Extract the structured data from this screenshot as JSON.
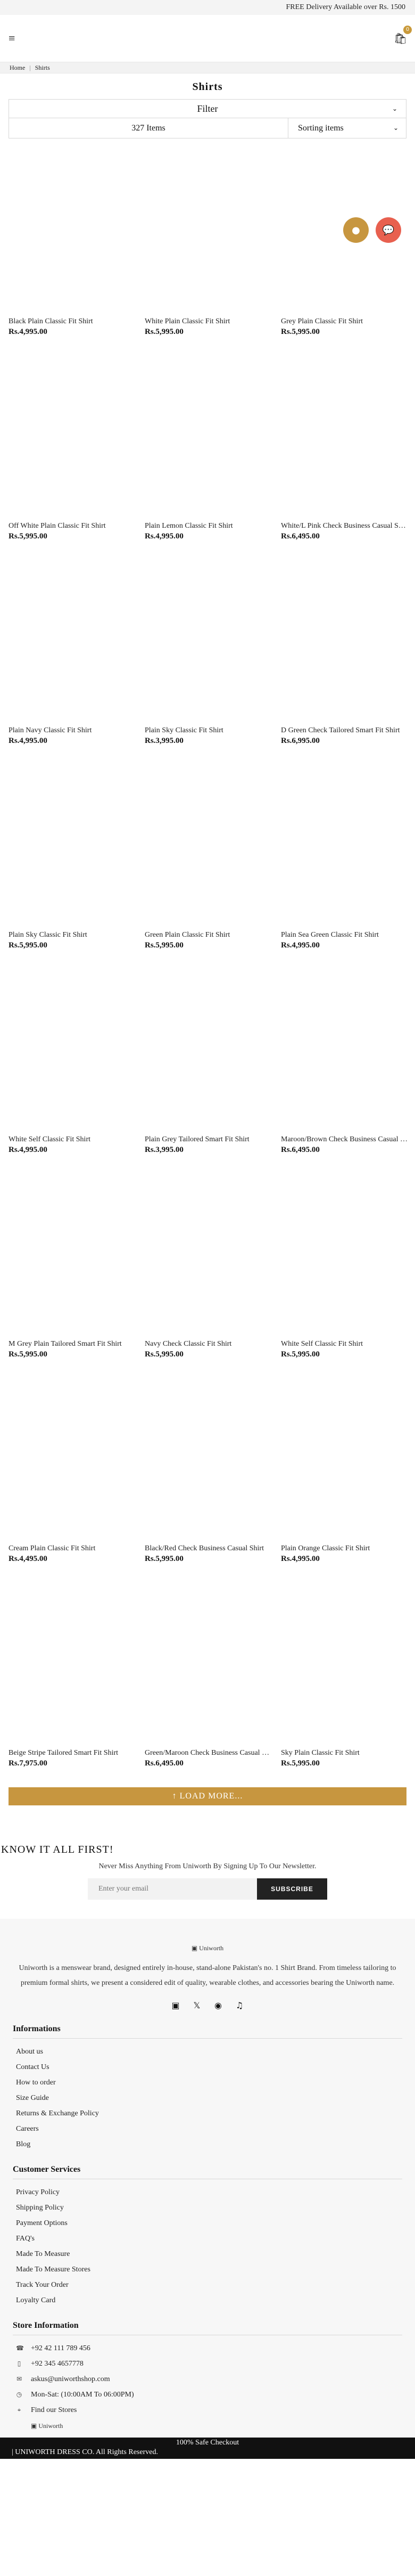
{
  "topbar": {
    "text": "FREE Delivery Available over Rs. 1500"
  },
  "header": {
    "menu_icon": "hamburger-icon",
    "cart_icon": "cart-icon",
    "cart_count": "0"
  },
  "breadcrumb": {
    "home": "Home",
    "current": "Shirts"
  },
  "page_title": "Shirts",
  "filter": {
    "label": "Filter"
  },
  "listing": {
    "count": "327 Items",
    "sort": "Sorting items"
  },
  "products": [
    {
      "name": "Black Plain Classic Fit Shirt",
      "price": "Rs.4,995.00"
    },
    {
      "name": "White Plain Classic Fit Shirt",
      "price": "Rs.5,995.00"
    },
    {
      "name": "Grey Plain Classic Fit Shirt",
      "price": "Rs.5,995.00"
    },
    {
      "name": "Off White Plain Classic Fit Shirt",
      "price": "Rs.5,995.00"
    },
    {
      "name": "Plain Lemon Classic Fit Shirt",
      "price": "Rs.4,995.00"
    },
    {
      "name": "White/L Pink Check Business Casual Shirt",
      "price": "Rs.6,495.00"
    },
    {
      "name": "Plain Navy Classic Fit Shirt",
      "price": "Rs.4,995.00"
    },
    {
      "name": "Plain Sky Classic Fit Shirt",
      "price": "Rs.3,995.00"
    },
    {
      "name": "D Green Check Tailored Smart Fit Shirt",
      "price": "Rs.6,995.00"
    },
    {
      "name": "Plain Sky Classic Fit Shirt",
      "price": "Rs.5,995.00"
    },
    {
      "name": "Green Plain Classic Fit Shirt",
      "price": "Rs.5,995.00"
    },
    {
      "name": "Plain Sea Green Classic Fit Shirt",
      "price": "Rs.4,995.00"
    },
    {
      "name": "White Self Classic Fit Shirt",
      "price": "Rs.4,995.00"
    },
    {
      "name": "Plain Grey Tailored Smart Fit Shirt",
      "price": "Rs.3,995.00"
    },
    {
      "name": "Maroon/Brown Check Business Casual Shirt",
      "price": "Rs.6,495.00"
    },
    {
      "name": "M Grey Plain Tailored Smart Fit Shirt",
      "price": "Rs.5,995.00"
    },
    {
      "name": "Navy Check Classic Fit Shirt",
      "price": "Rs.5,995.00"
    },
    {
      "name": "White Self Classic Fit Shirt",
      "price": "Rs.5,995.00"
    },
    {
      "name": "Cream Plain Classic Fit Shirt",
      "price": "Rs.4,495.00"
    },
    {
      "name": "Black/Red Check Business Casual Shirt",
      "price": "Rs.5,995.00"
    },
    {
      "name": "Plain Orange Classic Fit Shirt",
      "price": "Rs.4,995.00"
    },
    {
      "name": "Beige Stripe Tailored Smart Fit Shirt",
      "price": "Rs.7,975.00"
    },
    {
      "name": "Green/Maroon Check Business Casual Shirt",
      "price": "Rs.6,495.00"
    },
    {
      "name": "Sky Plain Classic Fit Shirt",
      "price": "Rs.5,995.00"
    }
  ],
  "load_more": "↑ LOAD MORE...",
  "newsletter": {
    "title": "KNOW IT ALL FIRST!",
    "subtitle": "Never Miss Anything From Uniworth By Signing Up To Our Newsletter.",
    "placeholder": "Enter your email",
    "button": "SUBSCRIBE"
  },
  "footer": {
    "logo_alt": "Uniworth",
    "about": "Uniworth is a menswear brand, designed entirely in-house, stand-alone Pakistan's no. 1 Shirt Brand. From timeless tailoring to premium formal shirts, we present a considered edit of quality, wearable clothes, and accessories bearing the Uniworth name.",
    "informations_title": "Informations",
    "informations": [
      "About us",
      "Contact Us",
      "How to order",
      "Size Guide",
      "Returns & Exchange Policy",
      "Careers",
      "Blog"
    ],
    "customer_title": "Customer Services",
    "customer": [
      "Privacy Policy",
      "Shipping Policy",
      "Payment Options",
      "FAQ's",
      "Made To Measure",
      "Made To Measure Stores",
      "Track Your Order",
      "Loyalty Card"
    ],
    "store_title": "Store Information",
    "store": [
      {
        "icon": "phone-icon",
        "glyph": "☎",
        "text": "+92 42 111 789 456"
      },
      {
        "icon": "mobile-icon",
        "glyph": "▯",
        "text": "+92 345 4657778"
      },
      {
        "icon": "email-icon",
        "glyph": "✉",
        "text": "askus@uniworthshop.com"
      },
      {
        "icon": "clock-icon",
        "glyph": "◷",
        "text": "Mon-Sat: (10:00AM To 06:00PM)"
      },
      {
        "icon": "map-pin-icon",
        "glyph": "⌖",
        "text": "Find our Stores"
      }
    ],
    "logo2_alt": "Uniworth"
  },
  "bottom": {
    "safe": "100% Safe Checkout",
    "copyright": "| UNIWORTH DRESS CO. All Rights Reserved."
  },
  "colors": {
    "accent": "#c7963f",
    "chat": "#e8604f",
    "dark": "#111111"
  }
}
